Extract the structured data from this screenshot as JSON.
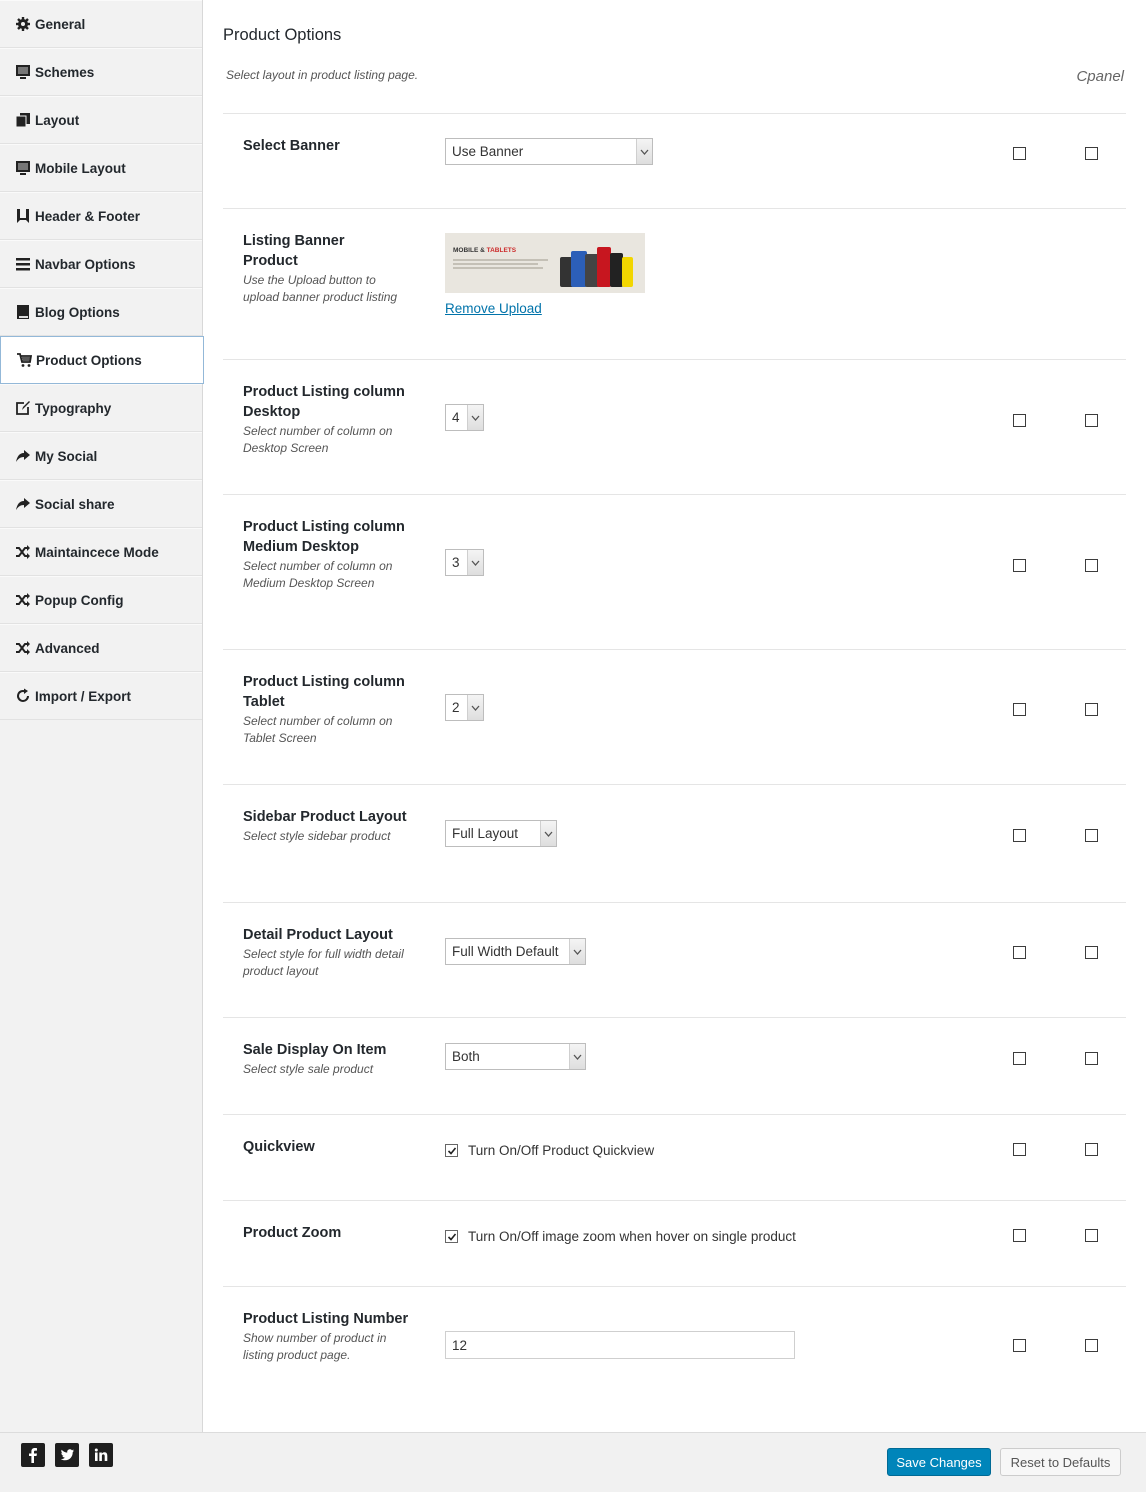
{
  "sidebar": {
    "items": [
      {
        "label": "General",
        "icon": "gear-icon"
      },
      {
        "label": "Schemes",
        "icon": "monitor-icon"
      },
      {
        "label": "Layout",
        "icon": "copy-icon"
      },
      {
        "label": "Mobile Layout",
        "icon": "monitor-icon"
      },
      {
        "label": "Header & Footer",
        "icon": "bookmark-icon"
      },
      {
        "label": "Navbar Options",
        "icon": "menu-icon"
      },
      {
        "label": "Blog Options",
        "icon": "book-icon"
      },
      {
        "label": "Product Options",
        "icon": "cart-icon",
        "active": true
      },
      {
        "label": "Typography",
        "icon": "edit-icon"
      },
      {
        "label": "My Social",
        "icon": "share-icon"
      },
      {
        "label": "Social share",
        "icon": "share-icon"
      },
      {
        "label": "Maintaincece Mode",
        "icon": "shuffle-icon"
      },
      {
        "label": "Popup Config",
        "icon": "shuffle-icon"
      },
      {
        "label": "Advanced",
        "icon": "shuffle-icon"
      },
      {
        "label": "Import / Export",
        "icon": "refresh-icon"
      }
    ]
  },
  "main": {
    "title": "Product Options",
    "description": "Select layout in product listing page.",
    "cpanel": "Cpanel",
    "select_banner": {
      "title": "Select Banner",
      "value": "Use Banner"
    },
    "listing_banner": {
      "title": "Listing Banner Product",
      "subtitle": "Use the Upload button to upload banner product listing",
      "banner_text_1": "MOBILE & ",
      "banner_text_2": "TABLETS",
      "remove_link": "Remove Upload"
    },
    "col_desktop": {
      "title": "Product Listing column Desktop",
      "subtitle": "Select number of column on Desktop Screen",
      "value": "4"
    },
    "col_medium": {
      "title": "Product Listing column Medium Desktop",
      "subtitle": "Select number of column on Medium Desktop Screen",
      "value": "3"
    },
    "col_tablet": {
      "title": "Product Listing column Tablet",
      "subtitle": "Select number of column on Tablet Screen",
      "value": "2"
    },
    "sidebar_layout": {
      "title": "Sidebar Product Layout",
      "subtitle": "Select style sidebar product",
      "value": "Full Layout"
    },
    "detail_layout": {
      "title": "Detail Product Layout",
      "subtitle": "Select style for full width detail product layout",
      "value": "Full Width Default"
    },
    "sale_display": {
      "title": "Sale Display On Item",
      "subtitle": "Select style sale product",
      "value": "Both"
    },
    "quickview": {
      "title": "Quickview",
      "label": "Turn On/Off Product Quickview",
      "checked": true
    },
    "zoom": {
      "title": "Product Zoom",
      "label": "Turn On/Off image zoom when hover on single product",
      "checked": true
    },
    "listing_number": {
      "title": "Product Listing Number",
      "subtitle": "Show number of product in listing product page.",
      "value": "12"
    }
  },
  "footer": {
    "social": [
      "facebook-icon",
      "twitter-icon",
      "linkedin-icon"
    ],
    "save_label": "Save Changes",
    "reset_label": "Reset to Defaults"
  },
  "colors": {
    "accent": "#0085ba",
    "link": "#0073aa",
    "sidebar_bg": "#f2f2f2"
  }
}
